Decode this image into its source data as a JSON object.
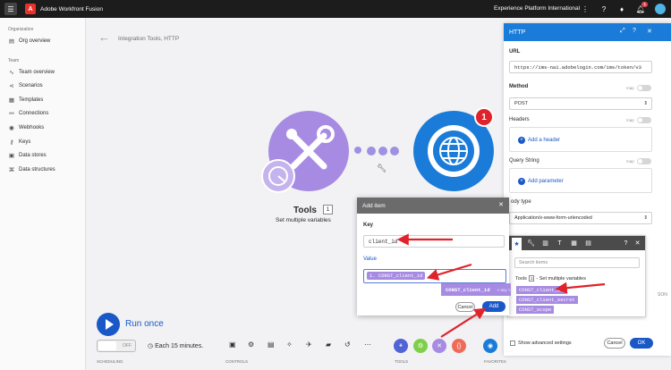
{
  "topbar": {
    "app_title": "Adobe Workfront Fusion",
    "org_name": "Experience Platform International",
    "notif_count": "1"
  },
  "sidebar": {
    "section_org": "Organization",
    "org_overview": "Org overview",
    "section_team": "Team",
    "items": [
      {
        "label": "Team overview",
        "icon": "team-icon"
      },
      {
        "label": "Scenarios",
        "icon": "share-icon"
      },
      {
        "label": "Templates",
        "icon": "templates-icon"
      },
      {
        "label": "Connections",
        "icon": "link-icon"
      },
      {
        "label": "Webhooks",
        "icon": "globe-icon"
      },
      {
        "label": "Keys",
        "icon": "key-icon"
      },
      {
        "label": "Data stores",
        "icon": "database-icon"
      },
      {
        "label": "Data structures",
        "icon": "structure-icon"
      }
    ]
  },
  "canvas": {
    "breadcrumb": "Integration Tools, HTTP",
    "tools_node": {
      "title": "Tools",
      "number": "1",
      "subtitle": "Set multiple variables"
    },
    "http_node": {
      "error_count": "1"
    }
  },
  "footer": {
    "run_once": "Run once",
    "toggle_state": "OFF",
    "schedule_text": "Each 15 minutes.",
    "label_scheduling": "SCHEDULING",
    "label_controls": "CONTROLS",
    "label_tools": "TOOLS",
    "label_favorites": "FAVORITES"
  },
  "http_panel": {
    "title": "HTTP",
    "url_label": "URL",
    "url_value": "https://ims-na1.adobelogin.com/ims/token/v3",
    "method_label": "Method",
    "method_value": "POST",
    "map_label": "map",
    "headers_label": "Headers",
    "add_header": "Add a header",
    "query_label": "Query String",
    "add_parameter": "Add parameter",
    "body_type_label": "ody type",
    "body_type_value": "Application/x-www-form-urlencoded",
    "show_advanced": "Show advanced settings",
    "cancel": "Cancel",
    "ok": "OK",
    "peek_son": "SON"
  },
  "add_item_dialog": {
    "title": "Add item",
    "key_label": "Key",
    "key_value": "client_id",
    "value_label": "Value",
    "value_pill": "1. CONST_client_id",
    "cancel": "Cancel",
    "add": "Add"
  },
  "drag_chip": {
    "label": "CONST_client_id",
    "type": "< any >"
  },
  "mapper": {
    "search_placeholder": "Search items",
    "module_name": "Tools",
    "module_num": "1",
    "module_desc": "- Set multiple variables",
    "items": [
      "CONST_client_id",
      "CONST_client_secret",
      "CONST_scope"
    ]
  },
  "colors": {
    "accent": "#1958c6",
    "tools_purple": "#a78be3",
    "http_blue": "#1a7cd8",
    "annotation_red": "#e0222b"
  }
}
